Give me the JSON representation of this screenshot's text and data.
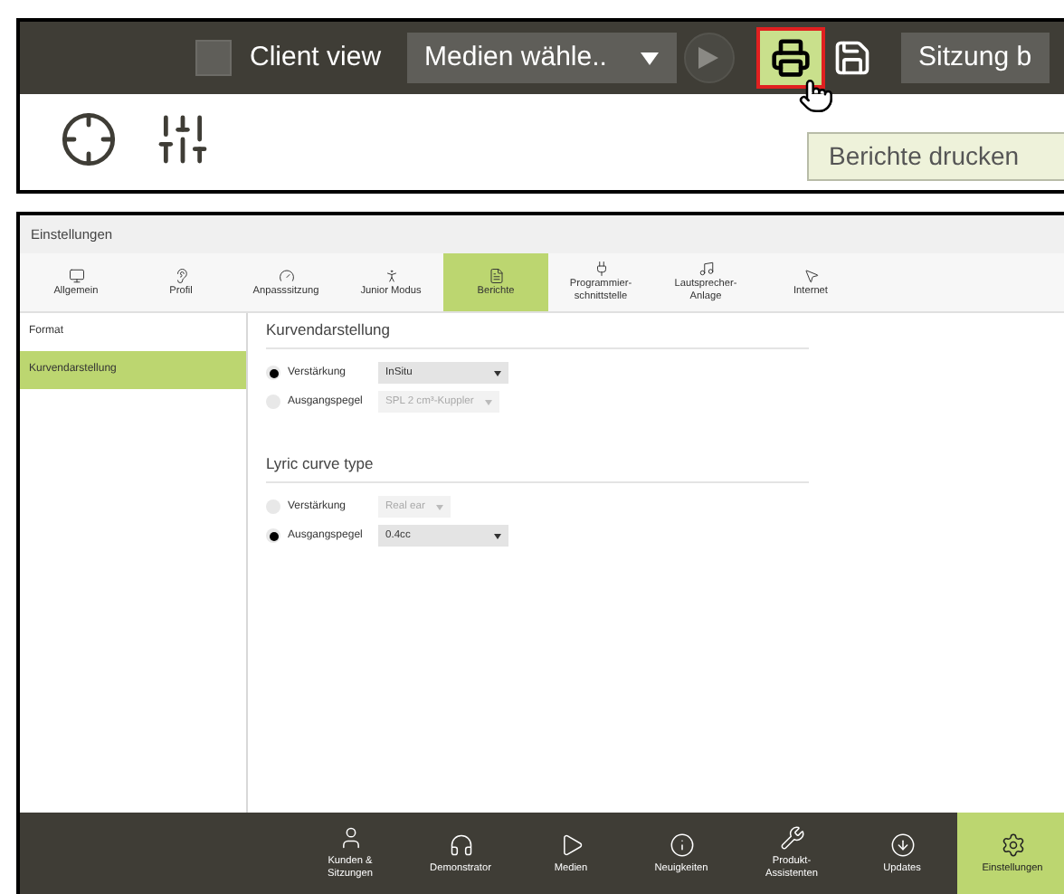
{
  "toolbar": {
    "client_view": {
      "label": "Client view",
      "checked": false
    },
    "media_dropdown": {
      "value": "Medien wähle.."
    },
    "print_button": {
      "highlighted": true
    },
    "session_button": {
      "label": "Sitzung b"
    },
    "tooltip": "Berichte drucken"
  },
  "window": {
    "title": "Einstellungen"
  },
  "tabs": [
    {
      "label": "Allgemein",
      "selected": false
    },
    {
      "label": "Profil",
      "selected": false
    },
    {
      "label": "Anpasssitzung",
      "selected": false
    },
    {
      "label": "Junior Modus",
      "selected": false
    },
    {
      "label": "Berichte",
      "selected": true
    },
    {
      "label": "Programmier-\nschnittstelle",
      "selected": false
    },
    {
      "label": "Lautsprecher-\nAnlage",
      "selected": false
    },
    {
      "label": "Internet",
      "selected": false
    }
  ],
  "sidebar": {
    "items": [
      {
        "label": "Format",
        "selected": false
      },
      {
        "label": "Kurvendarstellung",
        "selected": true
      }
    ]
  },
  "sections": [
    {
      "title": "Kurvendarstellung",
      "options": [
        {
          "label": "Verstärkung",
          "selected": true,
          "value": "InSitu",
          "disabled": false
        },
        {
          "label": "Ausgangspegel",
          "selected": false,
          "value": "SPL 2 cm³-Kuppler",
          "disabled": true
        }
      ]
    },
    {
      "title": "Lyric curve type",
      "options": [
        {
          "label": "Verstärkung",
          "selected": false,
          "value": "Real ear",
          "disabled": true
        },
        {
          "label": "Ausgangspegel",
          "selected": true,
          "value": "0.4cc",
          "disabled": false
        }
      ]
    }
  ],
  "bottom_nav": [
    {
      "label": "Kunden &\nSitzungen",
      "selected": false
    },
    {
      "label": "Demonstrator",
      "selected": false
    },
    {
      "label": "Medien",
      "selected": false
    },
    {
      "label": "Neuigkeiten",
      "selected": false
    },
    {
      "label": "Produkt-\nAssistenten",
      "selected": false
    },
    {
      "label": "Updates",
      "selected": false
    },
    {
      "label": "Einstellungen",
      "selected": true
    }
  ]
}
